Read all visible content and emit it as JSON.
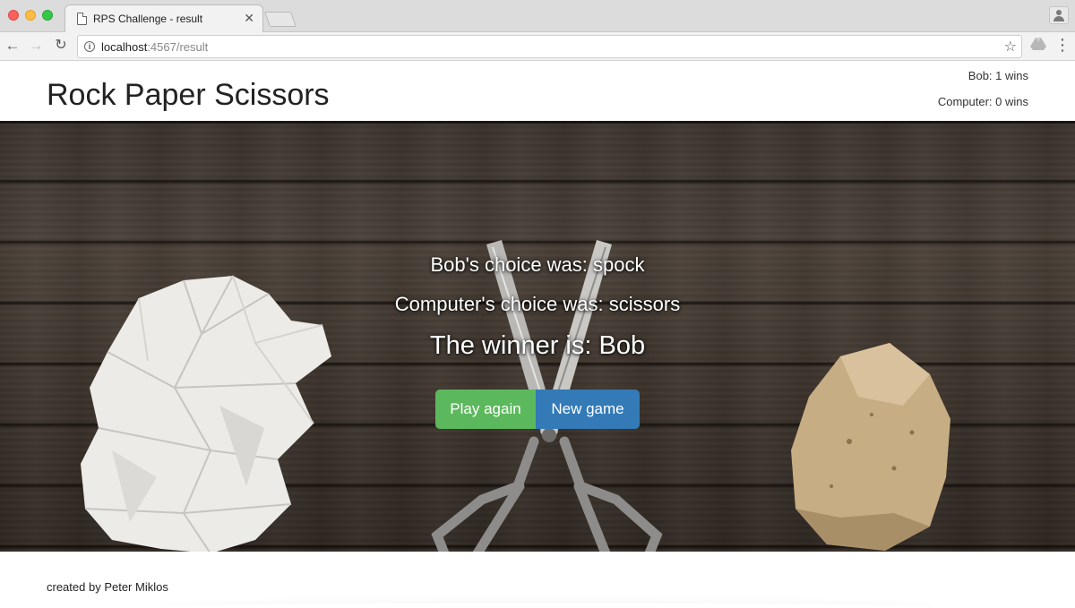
{
  "browser": {
    "tab_title": "RPS Challenge - result",
    "url_host": "localhost",
    "url_path": ":4567/result"
  },
  "header": {
    "title": "Rock Paper Scissors",
    "bob_score": "Bob: 1 wins",
    "computer_score": "Computer: 0 wins"
  },
  "result": {
    "bob_choice": "Bob's choice was: spock",
    "computer_choice": "Computer's choice was: scissors",
    "winner": "The winner is: Bob"
  },
  "actions": {
    "play_again_label": "Play again",
    "new_game_label": "New game"
  },
  "footer": {
    "credit": "created by Peter Miklos"
  },
  "colors": {
    "play_again": "#5cb85c",
    "new_game": "#337ab7",
    "wood": "#3e352d"
  }
}
